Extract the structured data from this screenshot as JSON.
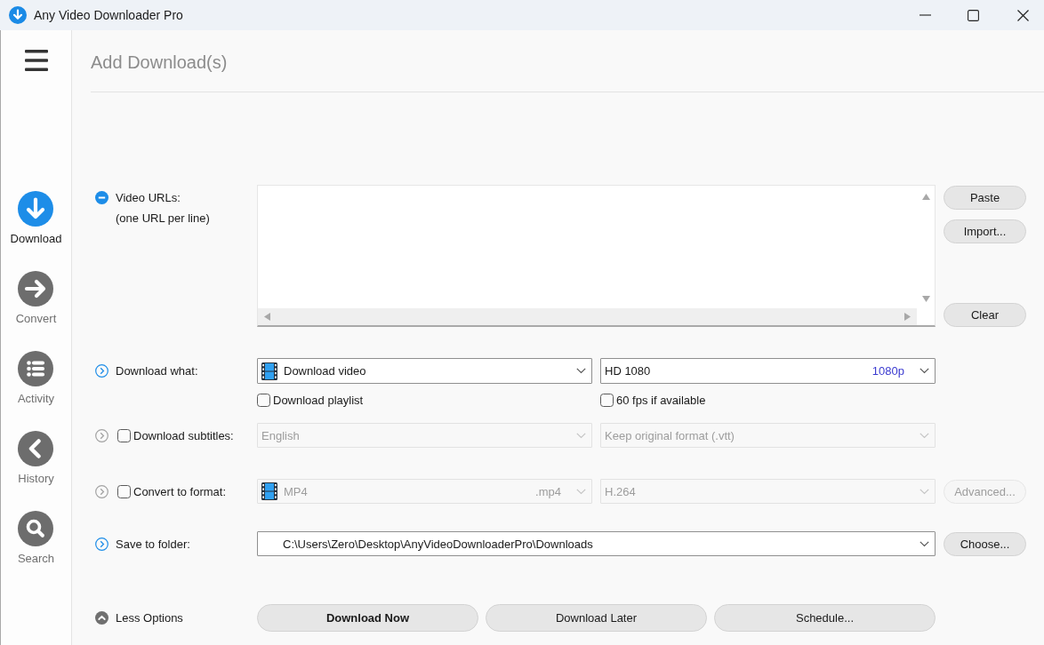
{
  "window": {
    "title": "Any Video Downloader Pro"
  },
  "sidebar": {
    "items": [
      {
        "label": "Download",
        "selected": true
      },
      {
        "label": "Convert",
        "selected": false
      },
      {
        "label": "Activity",
        "selected": false
      },
      {
        "label": "History",
        "selected": false
      },
      {
        "label": "Search",
        "selected": false
      }
    ]
  },
  "page_title": "Add Download(s)",
  "video_urls": {
    "label": "Video URLs:",
    "note": "(one URL per line)",
    "expanded": true,
    "buttons": [
      "Paste",
      "Import...",
      "Clear"
    ]
  },
  "options": [
    {
      "label": "Download what:",
      "expanded": false,
      "selects": [
        {
          "kind": "film",
          "value": "Download video",
          "disabled": false
        },
        {
          "kind": "plain",
          "value": "HD 1080",
          "tag": "1080p",
          "disabled": false
        }
      ],
      "checkboxes": [
        {
          "label": "Download playlist",
          "checked": false
        },
        {
          "label": "60 fps if available",
          "checked": false
        }
      ]
    },
    {
      "label": "Download subtitles:",
      "checked": false,
      "expanded": false,
      "selects": [
        {
          "kind": "plain",
          "value": "English",
          "disabled": true
        },
        {
          "kind": "plain",
          "value": "Keep original format (.vtt)",
          "disabled": true
        }
      ]
    },
    {
      "label": "Convert to format:",
      "checked": false,
      "expanded": false,
      "selects": [
        {
          "kind": "film",
          "value": "MP4",
          "tag": ".mp4",
          "disabled": true
        },
        {
          "kind": "plain",
          "value": "H.264",
          "disabled": true
        }
      ],
      "button": {
        "label": "Advanced...",
        "disabled": true
      }
    },
    {
      "label": "Save to folder:",
      "expanded": false,
      "selects": [
        {
          "kind": "path",
          "value": "C:\\Users\\Zero\\Desktop\\AnyVideoDownloaderPro\\Downloads",
          "disabled": false
        }
      ],
      "button": {
        "label": "Choose...",
        "disabled": false
      }
    }
  ],
  "footer": {
    "toggle": {
      "label": "Less Options",
      "expanded": true
    },
    "buttons": [
      {
        "label": "Download Now",
        "primary": true
      },
      {
        "label": "Download Later",
        "primary": false
      },
      {
        "label": "Schedule...",
        "primary": false
      }
    ]
  }
}
